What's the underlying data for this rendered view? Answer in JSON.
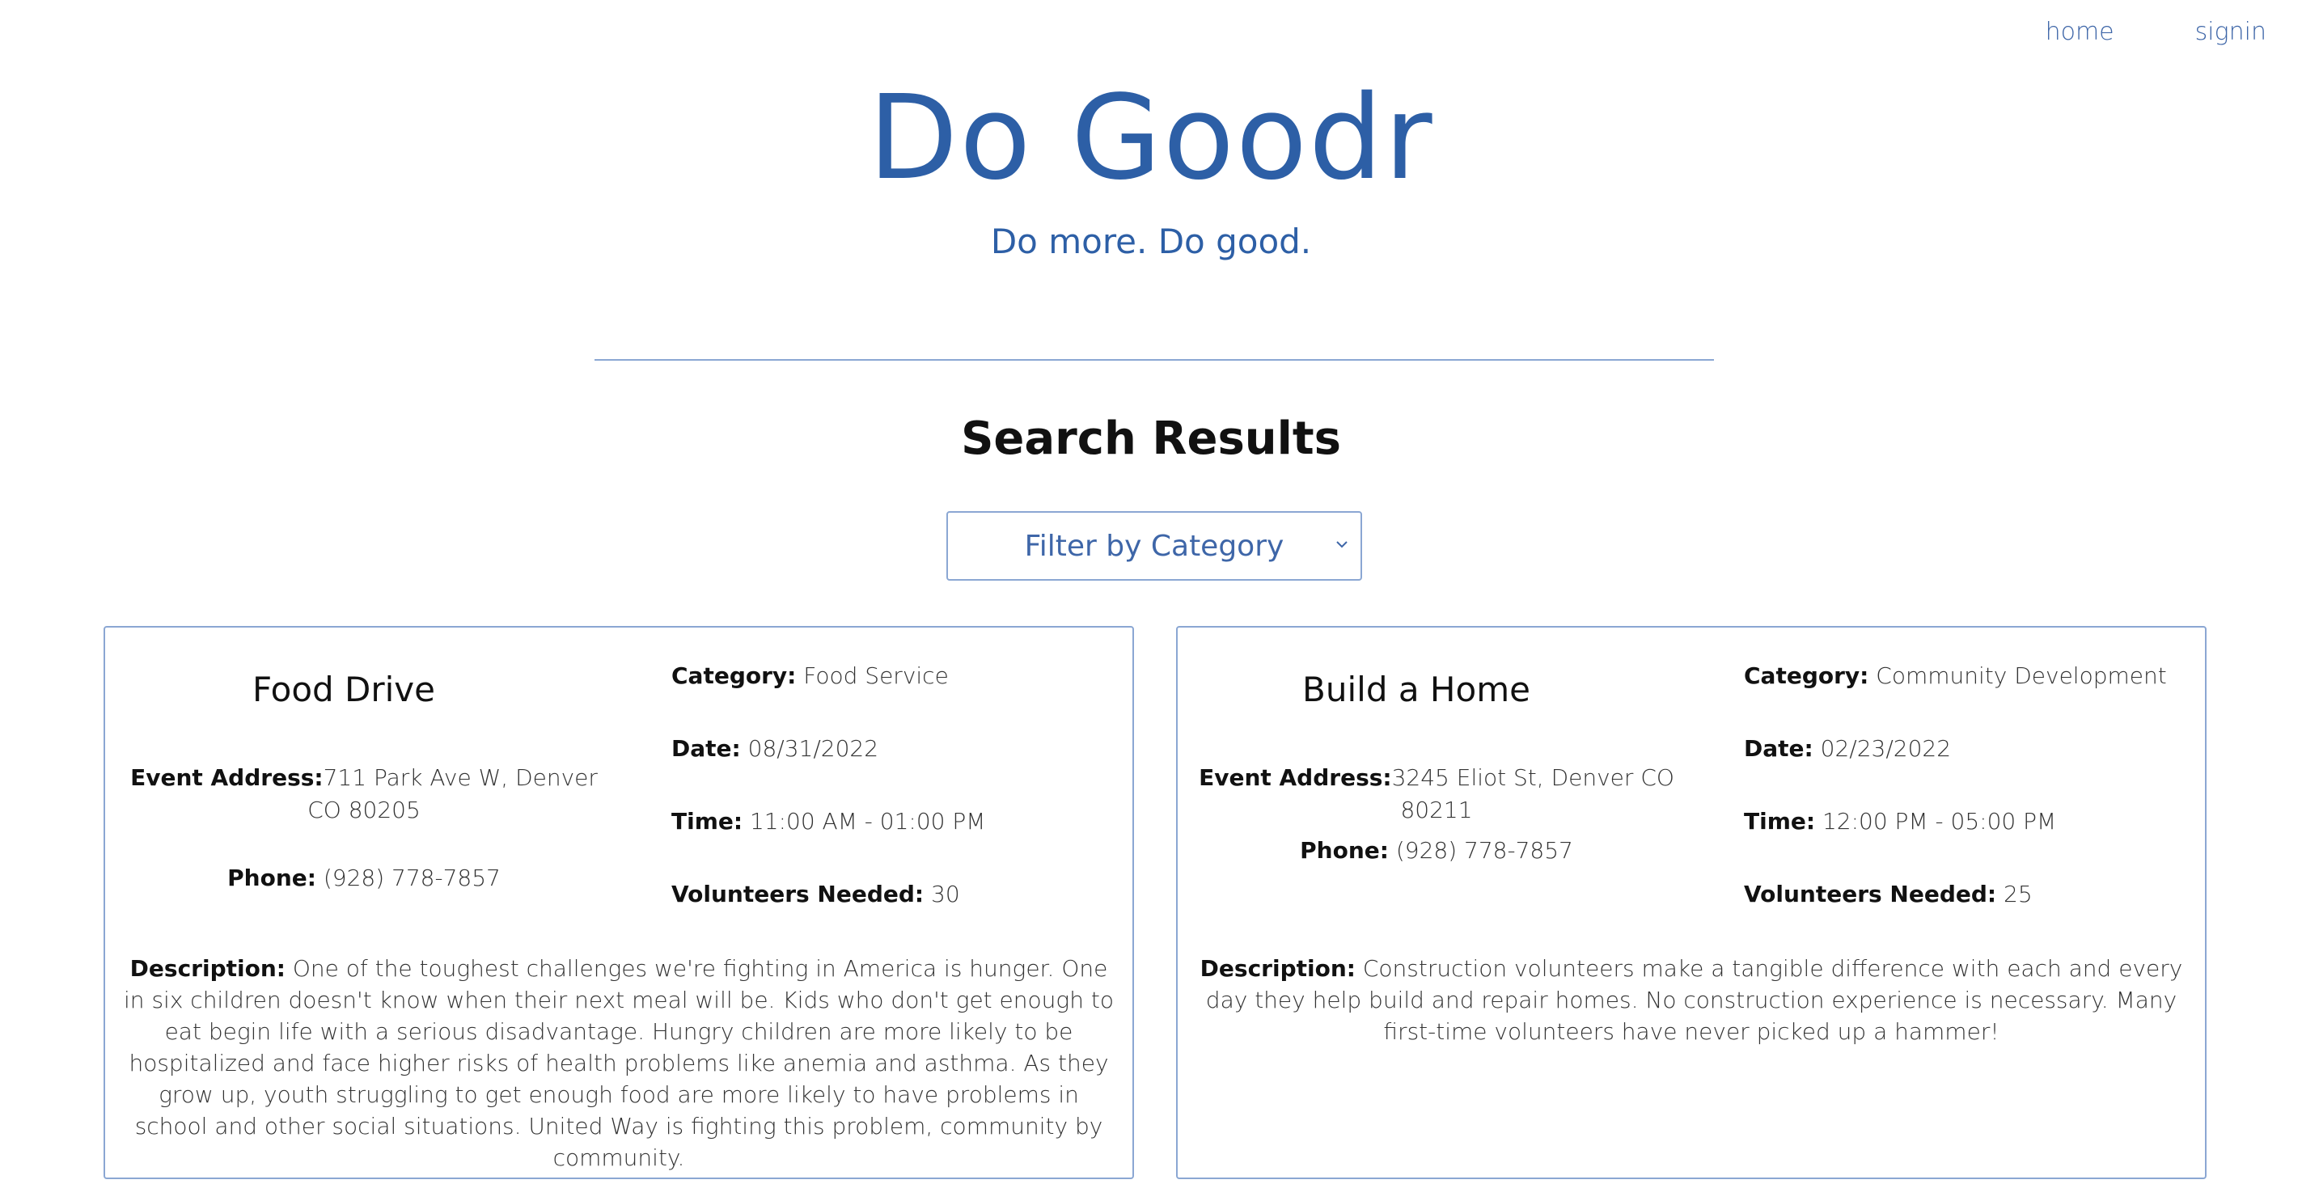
{
  "nav": {
    "home": "home",
    "signin": "signin"
  },
  "hero": {
    "brand": "Do Goodr",
    "tagline": "Do more. Do good."
  },
  "results": {
    "title": "Search Results"
  },
  "filter": {
    "placeholder": "Filter by Category"
  },
  "labels": {
    "address": "Event Address:",
    "phone": "Phone:",
    "category": "Category:",
    "date": "Date:",
    "time": "Time:",
    "volunteers": "Volunteers Needed:",
    "description": "Description:"
  },
  "events": [
    {
      "title": "Food Drive",
      "address": "711 Park Ave W, Denver CO 80205",
      "phone": "(928) 778-7857",
      "category": "Food Service",
      "date": "08/31/2022",
      "time": "11:00 AM - 01:00 PM",
      "volunteers": "30",
      "description": "One of the toughest challenges we're fighting in America is hunger. One in six children doesn't know when their next meal will be. Kids who don't get enough to eat begin life with a serious disadvantage. Hungry children are more likely to be hospitalized and face higher risks of health problems like anemia and asthma. As they grow up, youth struggling to get enough food are more likely to have problems in school and other social situations. United Way is fighting this problem, community by community."
    },
    {
      "title": "Build a Home",
      "address": "3245 Eliot St, Denver CO 80211",
      "phone": "(928) 778-7857",
      "category": "Community Development",
      "date": "02/23/2022",
      "time": "12:00 PM - 05:00 PM",
      "volunteers": "25",
      "description": "Construction volunteers make a tangible difference with each and every day they help build and repair homes. No construction experience is necessary. Many first-time volunteers have never picked up a hammer!"
    }
  ]
}
